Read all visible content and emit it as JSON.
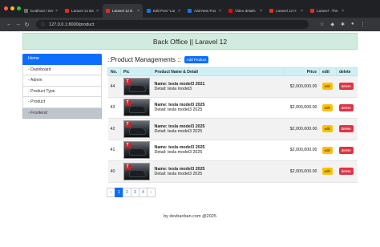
{
  "browser": {
    "tabs": [
      {
        "label": "localhost / Ser",
        "color": "#6e6e6e"
      },
      {
        "label": "Laravel 12 Ba",
        "color": "#d93025"
      },
      {
        "label": "Laravel 12 B",
        "color": "#d93025"
      },
      {
        "label": "Edit Post \"Lar",
        "color": "#1a73e8"
      },
      {
        "label": "Add New Pos",
        "color": "#1a73e8"
      },
      {
        "label": "Video details",
        "color": "#ff0000"
      },
      {
        "label": "Laravel 12 H",
        "color": "#d93025"
      },
      {
        "label": "Laravel - The",
        "color": "#d93025"
      }
    ],
    "url": "127.0.0.1:8000/product"
  },
  "header": {
    "title": "Back Office || Laravel 12"
  },
  "sidebar": {
    "items": [
      "Home",
      "- Dashboard",
      "- Admin",
      "- Product Type",
      "- Product",
      "- Frontend"
    ]
  },
  "main": {
    "title": "::Product Managements ::",
    "add_label": "Add Product",
    "columns": [
      "No.",
      "Pic",
      "Product Name & Detail",
      "Price",
      "edit",
      "delete"
    ],
    "rows": [
      {
        "no": "44",
        "name": "Name: tesla model3 2021",
        "detail": "Detail: tesla model3",
        "price": "$2,000,000.00",
        "edit": "edit",
        "delete": "delete"
      },
      {
        "no": "43",
        "name": "Name: tesla model3 2025",
        "detail": "Detail: tesla model3 2025",
        "price": "$2,000,000.00",
        "edit": "edit",
        "delete": "delete"
      },
      {
        "no": "42",
        "name": "Name: tesla model3 2025",
        "detail": "Detail: tesla model3 2025",
        "price": "$2,000,000.00",
        "edit": "edit",
        "delete": "delete"
      },
      {
        "no": "41",
        "name": "Name: tesla model3 2025",
        "detail": "Detail: tesla model3 2025",
        "price": "$2,000,000.00",
        "edit": "edit",
        "delete": "delete"
      },
      {
        "no": "40",
        "name": "Name: tesla model3 2025",
        "detail": "Detail: tesla model3 2025",
        "price": "$2,000,000.00",
        "edit": "edit",
        "delete": "delete"
      }
    ]
  },
  "pagination": {
    "prev": "‹",
    "pages": [
      "1",
      "2",
      "3",
      "4"
    ],
    "next": "›",
    "active": "1"
  },
  "footer": {
    "text": "by devbanban.com @2025"
  },
  "colors": {
    "accent": "#0d6efd",
    "header_bg": "#d1ecdf",
    "edit": "#ffc107",
    "delete": "#dc3545"
  }
}
